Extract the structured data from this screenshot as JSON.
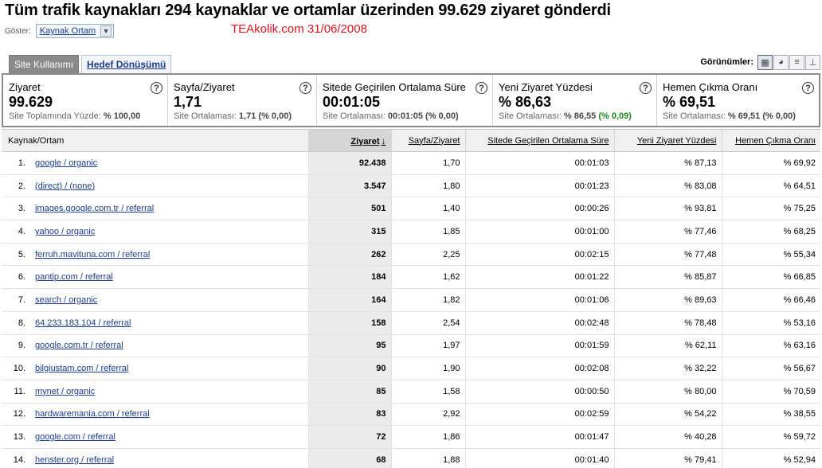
{
  "header": {
    "title": "Tüm trafik kaynakları 294 kaynaklar ve ortamlar üzerinden 99.629 ziyaret gönderdi",
    "show_label": "Göster:",
    "show_value": "Kaynak Ortam",
    "watermark": "TEAkolik.com   31/06/2008"
  },
  "tabs": [
    {
      "label": "Site Kullanımı",
      "active": true
    },
    {
      "label": "Hedef Dönüşümü",
      "active": false
    }
  ],
  "views": {
    "label": "Görünümler:",
    "buttons": [
      {
        "icon": "table-icon",
        "glyph": "▦"
      },
      {
        "icon": "pie-chart-icon",
        "glyph": "◕"
      },
      {
        "icon": "bar-chart-icon",
        "glyph": "≡"
      },
      {
        "icon": "comparison-icon",
        "glyph": "⊥"
      }
    ]
  },
  "summary": [
    {
      "name": "Ziyaret",
      "value": "99.629",
      "sub_label": "Site Toplamında Yüzde:",
      "sub_value": "% 100,00",
      "sub_extra": ""
    },
    {
      "name": "Sayfa/Ziyaret",
      "value": "1,71",
      "sub_label": "Site Ortalaması:",
      "sub_value": "1,71",
      "sub_extra": "(% 0,00)"
    },
    {
      "name": "Sitede Geçirilen Ortalama Süre",
      "value": "00:01:05",
      "sub_label": "Site Ortalaması:",
      "sub_value": "00:01:05",
      "sub_extra": "(% 0,00)"
    },
    {
      "name": "Yeni Ziyaret Yüzdesi",
      "value": "% 86,63",
      "sub_label": "Site Ortalaması:",
      "sub_value": "% 86,55",
      "sub_extra": "(% 0,09)"
    },
    {
      "name": "Hemen Çıkma Oranı",
      "value": "% 69,51",
      "sub_label": "Site Ortalaması:",
      "sub_value": "% 69,51",
      "sub_extra": "(% 0,00)"
    }
  ],
  "table": {
    "columns": [
      "Kaynak/Ortam",
      "Ziyaret",
      "Sayfa/Ziyaret",
      "Sitede Geçirilen Ortalama Süre",
      "Yeni Ziyaret Yüzdesi",
      "Hemen Çıkma Oranı"
    ],
    "rows": [
      [
        "1.",
        "google / organic",
        "92.438",
        "1,70",
        "00:01:03",
        "% 87,13",
        "% 69,92"
      ],
      [
        "2.",
        "(direct) / (none)",
        "3.547",
        "1,80",
        "00:01:23",
        "% 83,08",
        "% 64,51"
      ],
      [
        "3.",
        "images.google.com.tr / referral",
        "501",
        "1,40",
        "00:00:26",
        "% 93,81",
        "% 75,25"
      ],
      [
        "4.",
        "yahoo / organic",
        "315",
        "1,85",
        "00:01:00",
        "% 77,46",
        "% 68,25"
      ],
      [
        "5.",
        "ferruh.mavituna.com / referral",
        "262",
        "2,25",
        "00:02:15",
        "% 77,48",
        "% 55,34"
      ],
      [
        "6.",
        "pantip.com / referral",
        "184",
        "1,62",
        "00:01:22",
        "% 85,87",
        "% 66,85"
      ],
      [
        "7.",
        "search / organic",
        "164",
        "1,82",
        "00:01:06",
        "% 89,63",
        "% 66,46"
      ],
      [
        "8.",
        "64.233.183.104 / referral",
        "158",
        "2,54",
        "00:02:48",
        "% 78,48",
        "% 53,16"
      ],
      [
        "9.",
        "google.com.tr / referral",
        "95",
        "1,97",
        "00:01:59",
        "% 62,11",
        "% 63,16"
      ],
      [
        "10.",
        "bilgiustam.com / referral",
        "90",
        "1,90",
        "00:02:08",
        "% 32,22",
        "% 56,67"
      ],
      [
        "11.",
        "mynet / organic",
        "85",
        "1,58",
        "00:00:50",
        "% 80,00",
        "% 70,59"
      ],
      [
        "12.",
        "hardwaremania.com / referral",
        "83",
        "2,92",
        "00:02:59",
        "% 54,22",
        "% 38,55"
      ],
      [
        "13.",
        "google.com / referral",
        "72",
        "1,86",
        "00:01:47",
        "% 40,28",
        "% 59,72"
      ],
      [
        "14.",
        "henster.org / referral",
        "68",
        "1,88",
        "00:01:40",
        "% 79,41",
        "% 52,94"
      ]
    ]
  }
}
